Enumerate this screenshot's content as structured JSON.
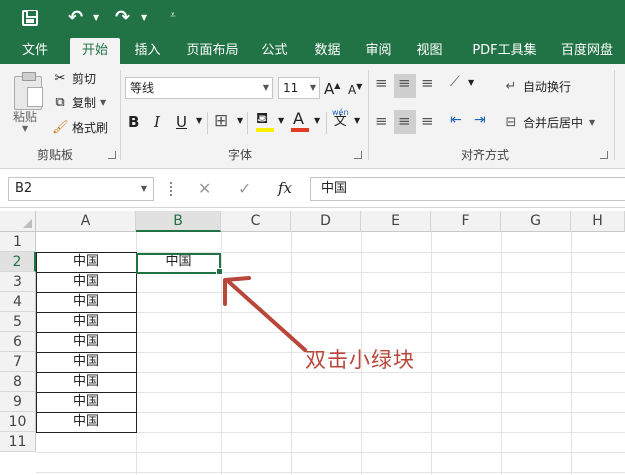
{
  "quick_access": {
    "save_icon": "save-icon",
    "undo_icon": "undo-icon",
    "redo_icon": "redo-icon"
  },
  "tabs": [
    {
      "label": "文件"
    },
    {
      "label": "开始"
    },
    {
      "label": "插入"
    },
    {
      "label": "页面布局"
    },
    {
      "label": "公式"
    },
    {
      "label": "数据"
    },
    {
      "label": "审阅"
    },
    {
      "label": "视图"
    },
    {
      "label": "PDF工具集"
    },
    {
      "label": "百度网盘"
    }
  ],
  "ribbon": {
    "clipboard": {
      "paste_label": "粘贴",
      "cut_label": "剪切",
      "copy_label": "复制",
      "format_painter_label": "格式刷",
      "group_label": "剪贴板"
    },
    "font": {
      "font_name": "等线",
      "font_size": "11",
      "increase_size": "A",
      "decrease_size": "A",
      "bold": "B",
      "italic": "I",
      "underline": "U",
      "font_color_glyph": "A",
      "phonetic_glyph": "wén",
      "phonetic_char": "文",
      "group_label": "字体"
    },
    "alignment": {
      "wrap_text_label": "自动换行",
      "merge_center_label": "合并后居中",
      "group_label": "对齐方式"
    },
    "font_color": "#e03b24",
    "fill_color": "#ffef00"
  },
  "formula_bar": {
    "name_box": "B2",
    "cancel_glyph": "✕",
    "enter_glyph": "✓",
    "fx_glyph": "fx",
    "formula": "中国"
  },
  "sheet": {
    "columns": [
      "A",
      "B",
      "C",
      "D",
      "E",
      "F",
      "G",
      "H"
    ],
    "rows": [
      "1",
      "2",
      "3",
      "4",
      "5",
      "6",
      "7",
      "8",
      "9",
      "10",
      "11"
    ],
    "cells": {
      "A2": "中国",
      "A3": "中国",
      "A4": "中国",
      "A5": "中国",
      "A6": "中国",
      "A7": "中国",
      "A8": "中国",
      "A9": "中国",
      "A10": "中国",
      "B2": "中国"
    },
    "active_cell": "B2",
    "accent_color": "#217346"
  },
  "annotation": {
    "text": "双击小绿块",
    "color": "#b8473a"
  }
}
